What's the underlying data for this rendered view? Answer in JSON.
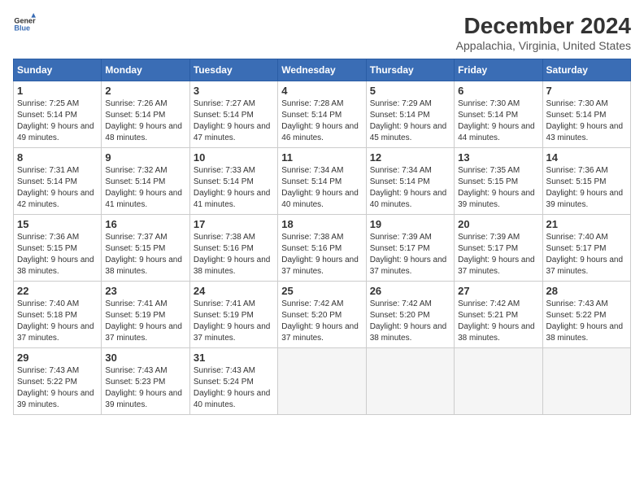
{
  "header": {
    "logo_line1": "General",
    "logo_line2": "Blue",
    "month": "December 2024",
    "location": "Appalachia, Virginia, United States"
  },
  "weekdays": [
    "Sunday",
    "Monday",
    "Tuesday",
    "Wednesday",
    "Thursday",
    "Friday",
    "Saturday"
  ],
  "weeks": [
    [
      {
        "day": "1",
        "rise": "Sunrise: 7:25 AM",
        "set": "Sunset: 5:14 PM",
        "light": "Daylight: 9 hours and 49 minutes."
      },
      {
        "day": "2",
        "rise": "Sunrise: 7:26 AM",
        "set": "Sunset: 5:14 PM",
        "light": "Daylight: 9 hours and 48 minutes."
      },
      {
        "day": "3",
        "rise": "Sunrise: 7:27 AM",
        "set": "Sunset: 5:14 PM",
        "light": "Daylight: 9 hours and 47 minutes."
      },
      {
        "day": "4",
        "rise": "Sunrise: 7:28 AM",
        "set": "Sunset: 5:14 PM",
        "light": "Daylight: 9 hours and 46 minutes."
      },
      {
        "day": "5",
        "rise": "Sunrise: 7:29 AM",
        "set": "Sunset: 5:14 PM",
        "light": "Daylight: 9 hours and 45 minutes."
      },
      {
        "day": "6",
        "rise": "Sunrise: 7:30 AM",
        "set": "Sunset: 5:14 PM",
        "light": "Daylight: 9 hours and 44 minutes."
      },
      {
        "day": "7",
        "rise": "Sunrise: 7:30 AM",
        "set": "Sunset: 5:14 PM",
        "light": "Daylight: 9 hours and 43 minutes."
      }
    ],
    [
      {
        "day": "8",
        "rise": "Sunrise: 7:31 AM",
        "set": "Sunset: 5:14 PM",
        "light": "Daylight: 9 hours and 42 minutes."
      },
      {
        "day": "9",
        "rise": "Sunrise: 7:32 AM",
        "set": "Sunset: 5:14 PM",
        "light": "Daylight: 9 hours and 41 minutes."
      },
      {
        "day": "10",
        "rise": "Sunrise: 7:33 AM",
        "set": "Sunset: 5:14 PM",
        "light": "Daylight: 9 hours and 41 minutes."
      },
      {
        "day": "11",
        "rise": "Sunrise: 7:34 AM",
        "set": "Sunset: 5:14 PM",
        "light": "Daylight: 9 hours and 40 minutes."
      },
      {
        "day": "12",
        "rise": "Sunrise: 7:34 AM",
        "set": "Sunset: 5:14 PM",
        "light": "Daylight: 9 hours and 40 minutes."
      },
      {
        "day": "13",
        "rise": "Sunrise: 7:35 AM",
        "set": "Sunset: 5:15 PM",
        "light": "Daylight: 9 hours and 39 minutes."
      },
      {
        "day": "14",
        "rise": "Sunrise: 7:36 AM",
        "set": "Sunset: 5:15 PM",
        "light": "Daylight: 9 hours and 39 minutes."
      }
    ],
    [
      {
        "day": "15",
        "rise": "Sunrise: 7:36 AM",
        "set": "Sunset: 5:15 PM",
        "light": "Daylight: 9 hours and 38 minutes."
      },
      {
        "day": "16",
        "rise": "Sunrise: 7:37 AM",
        "set": "Sunset: 5:15 PM",
        "light": "Daylight: 9 hours and 38 minutes."
      },
      {
        "day": "17",
        "rise": "Sunrise: 7:38 AM",
        "set": "Sunset: 5:16 PM",
        "light": "Daylight: 9 hours and 38 minutes."
      },
      {
        "day": "18",
        "rise": "Sunrise: 7:38 AM",
        "set": "Sunset: 5:16 PM",
        "light": "Daylight: 9 hours and 37 minutes."
      },
      {
        "day": "19",
        "rise": "Sunrise: 7:39 AM",
        "set": "Sunset: 5:17 PM",
        "light": "Daylight: 9 hours and 37 minutes."
      },
      {
        "day": "20",
        "rise": "Sunrise: 7:39 AM",
        "set": "Sunset: 5:17 PM",
        "light": "Daylight: 9 hours and 37 minutes."
      },
      {
        "day": "21",
        "rise": "Sunrise: 7:40 AM",
        "set": "Sunset: 5:17 PM",
        "light": "Daylight: 9 hours and 37 minutes."
      }
    ],
    [
      {
        "day": "22",
        "rise": "Sunrise: 7:40 AM",
        "set": "Sunset: 5:18 PM",
        "light": "Daylight: 9 hours and 37 minutes."
      },
      {
        "day": "23",
        "rise": "Sunrise: 7:41 AM",
        "set": "Sunset: 5:19 PM",
        "light": "Daylight: 9 hours and 37 minutes."
      },
      {
        "day": "24",
        "rise": "Sunrise: 7:41 AM",
        "set": "Sunset: 5:19 PM",
        "light": "Daylight: 9 hours and 37 minutes."
      },
      {
        "day": "25",
        "rise": "Sunrise: 7:42 AM",
        "set": "Sunset: 5:20 PM",
        "light": "Daylight: 9 hours and 37 minutes."
      },
      {
        "day": "26",
        "rise": "Sunrise: 7:42 AM",
        "set": "Sunset: 5:20 PM",
        "light": "Daylight: 9 hours and 38 minutes."
      },
      {
        "day": "27",
        "rise": "Sunrise: 7:42 AM",
        "set": "Sunset: 5:21 PM",
        "light": "Daylight: 9 hours and 38 minutes."
      },
      {
        "day": "28",
        "rise": "Sunrise: 7:43 AM",
        "set": "Sunset: 5:22 PM",
        "light": "Daylight: 9 hours and 38 minutes."
      }
    ],
    [
      {
        "day": "29",
        "rise": "Sunrise: 7:43 AM",
        "set": "Sunset: 5:22 PM",
        "light": "Daylight: 9 hours and 39 minutes."
      },
      {
        "day": "30",
        "rise": "Sunrise: 7:43 AM",
        "set": "Sunset: 5:23 PM",
        "light": "Daylight: 9 hours and 39 minutes."
      },
      {
        "day": "31",
        "rise": "Sunrise: 7:43 AM",
        "set": "Sunset: 5:24 PM",
        "light": "Daylight: 9 hours and 40 minutes."
      },
      null,
      null,
      null,
      null
    ]
  ]
}
